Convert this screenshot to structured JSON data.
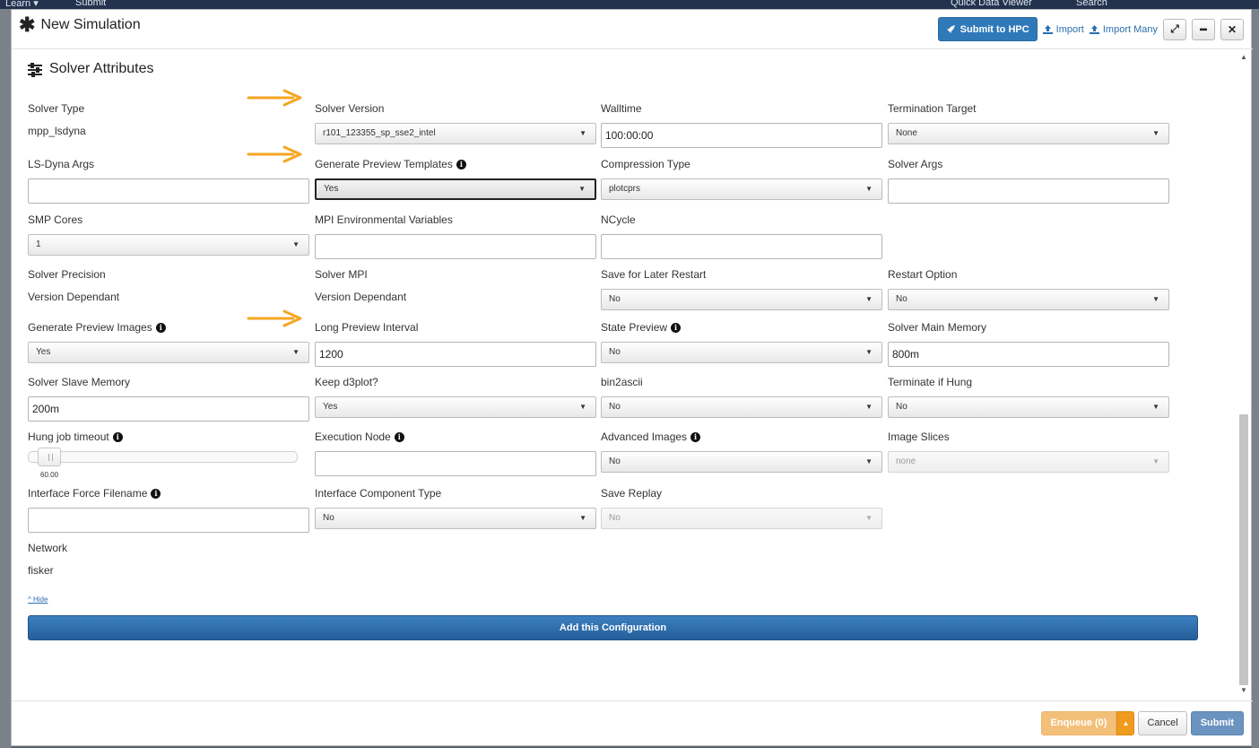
{
  "background": {
    "menu_learn": "Learn ▾",
    "menu_submit": "Submit",
    "quick_viewer": "Quick Data Viewer",
    "search": "Search"
  },
  "header": {
    "title": "New Simulation",
    "submit_hpc": "Submit to HPC",
    "import": "Import",
    "import_many": "Import Many"
  },
  "section": {
    "title": "Solver Attributes"
  },
  "fields": {
    "solver_type": {
      "label": "Solver Type",
      "value": "mpp_lsdyna"
    },
    "solver_version": {
      "label": "Solver Version",
      "value": "r101_123355_sp_sse2_intel"
    },
    "walltime": {
      "label": "Walltime",
      "value": "100:00:00"
    },
    "termination_target": {
      "label": "Termination Target",
      "value": "None"
    },
    "lsdyna_args": {
      "label": "LS-Dyna Args",
      "value": ""
    },
    "generate_preview_templates": {
      "label": "Generate Preview Templates",
      "value": "Yes"
    },
    "compression_type": {
      "label": "Compression Type",
      "value": "plotcprs"
    },
    "solver_args": {
      "label": "Solver Args",
      "value": ""
    },
    "smp_cores": {
      "label": "SMP Cores",
      "value": "1"
    },
    "mpi_env_vars": {
      "label": "MPI Environmental Variables",
      "value": ""
    },
    "ncycle": {
      "label": "NCycle",
      "value": ""
    },
    "solver_precision": {
      "label": "Solver Precision",
      "value": "Version Dependant"
    },
    "solver_mpi": {
      "label": "Solver MPI",
      "value": "Version Dependant"
    },
    "save_later_restart": {
      "label": "Save for Later Restart",
      "value": "No"
    },
    "restart_option": {
      "label": "Restart Option",
      "value": "No"
    },
    "generate_preview_images": {
      "label": "Generate Preview Images",
      "value": "Yes"
    },
    "long_preview_interval": {
      "label": "Long Preview Interval",
      "value": "1200"
    },
    "state_preview": {
      "label": "State Preview",
      "value": "No"
    },
    "solver_main_memory": {
      "label": "Solver Main Memory",
      "value": "800m"
    },
    "solver_slave_memory": {
      "label": "Solver Slave Memory",
      "value": "200m"
    },
    "keep_d3plot": {
      "label": "Keep d3plot?",
      "value": "Yes"
    },
    "bin2ascii": {
      "label": "bin2ascii",
      "value": "No"
    },
    "terminate_if_hung": {
      "label": "Terminate if Hung",
      "value": "No"
    },
    "hung_job_timeout": {
      "label": "Hung job timeout",
      "value": "60.00",
      "fraction": 0.05
    },
    "execution_node": {
      "label": "Execution Node",
      "value": ""
    },
    "advanced_images": {
      "label": "Advanced Images",
      "value": "No"
    },
    "image_slices": {
      "label": "Image Slices",
      "value": "none"
    },
    "interface_force_filename": {
      "label": "Interface Force Filename",
      "value": ""
    },
    "interface_component_type": {
      "label": "Interface Component Type",
      "value": "No"
    },
    "save_replay": {
      "label": "Save Replay",
      "value": "No"
    },
    "network": {
      "label": "Network",
      "value": "fisker"
    }
  },
  "hide_link": "^ Hide",
  "add_config": "Add this Configuration",
  "footer": {
    "enqueue": "Enqueue (0)",
    "cancel": "Cancel",
    "submit": "Submit"
  },
  "colors": {
    "primary": "#2f79b9",
    "arrow": "#f5a623",
    "enqueue": "#f3c07a"
  }
}
